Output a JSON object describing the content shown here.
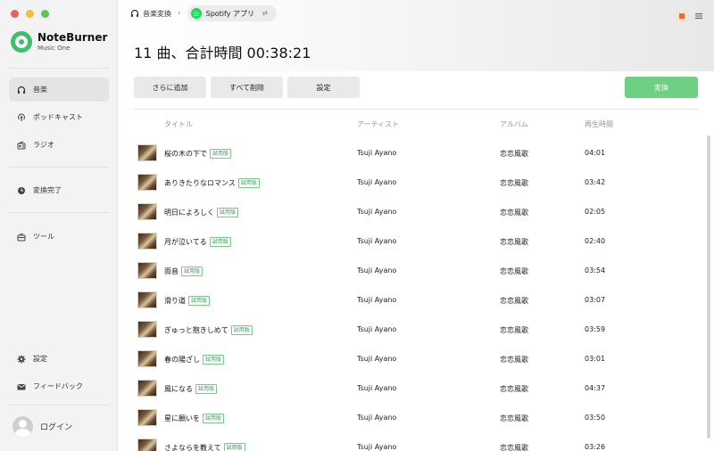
{
  "app": {
    "name": "NoteBurner",
    "subtitle": "Music One"
  },
  "sidebar": {
    "items": [
      {
        "label": "音楽",
        "icon": "headphones-icon"
      },
      {
        "label": "ポッドキャスト",
        "icon": "podcast-icon"
      },
      {
        "label": "ラジオ",
        "icon": "radio-icon"
      },
      {
        "label": "変換完了",
        "icon": "clock-icon"
      },
      {
        "label": "ツール",
        "icon": "toolbox-icon"
      },
      {
        "label": "設定",
        "icon": "gear-icon"
      },
      {
        "label": "フィードバック",
        "icon": "mail-icon"
      }
    ],
    "login_label": "ログイン"
  },
  "breadcrumb": {
    "root": "音楽変換",
    "current": "Spotify アプリ",
    "pill_symbol": "⇄"
  },
  "summary": "11 曲、合計時間 00:38:21",
  "toolbar": {
    "add_label": "さらに追加",
    "delete_all_label": "すべて削除",
    "settings_label": "設定",
    "convert_label": "変換"
  },
  "table": {
    "headers": {
      "title": "タイトル",
      "artist": "アーティスト",
      "album": "アルバム",
      "duration": "再生時間"
    },
    "badge_label": "試用版",
    "rows": [
      {
        "title": "桜の木の下で",
        "artist": "Tsuji Ayano",
        "album": "恋恋風歌",
        "duration": "04:01"
      },
      {
        "title": "ありきたりなロマンス",
        "artist": "Tsuji Ayano",
        "album": "恋恋風歌",
        "duration": "03:42"
      },
      {
        "title": "明日によろしく",
        "artist": "Tsuji Ayano",
        "album": "恋恋風歌",
        "duration": "02:05"
      },
      {
        "title": "月が泣いてる",
        "artist": "Tsuji Ayano",
        "album": "恋恋風歌",
        "duration": "02:40"
      },
      {
        "title": "雨音",
        "artist": "Tsuji Ayano",
        "album": "恋恋風歌",
        "duration": "03:54"
      },
      {
        "title": "滑り道",
        "artist": "Tsuji Ayano",
        "album": "恋恋風歌",
        "duration": "03:07"
      },
      {
        "title": "ぎゅっと抱きしめて",
        "artist": "Tsuji Ayano",
        "album": "恋恋風歌",
        "duration": "03:59"
      },
      {
        "title": "春の陽ざし",
        "artist": "Tsuji Ayano",
        "album": "恋恋風歌",
        "duration": "03:01"
      },
      {
        "title": "風になる",
        "artist": "Tsuji Ayano",
        "album": "恋恋風歌",
        "duration": "04:37"
      },
      {
        "title": "星に願いを",
        "artist": "Tsuji Ayano",
        "album": "恋恋風歌",
        "duration": "03:50"
      },
      {
        "title": "さよならを教えて",
        "artist": "Tsuji Ayano",
        "album": "恋恋風歌",
        "duration": "03:26"
      }
    ]
  },
  "colors": {
    "accent": "#6fcf83",
    "brand": "#3fbf6a"
  }
}
